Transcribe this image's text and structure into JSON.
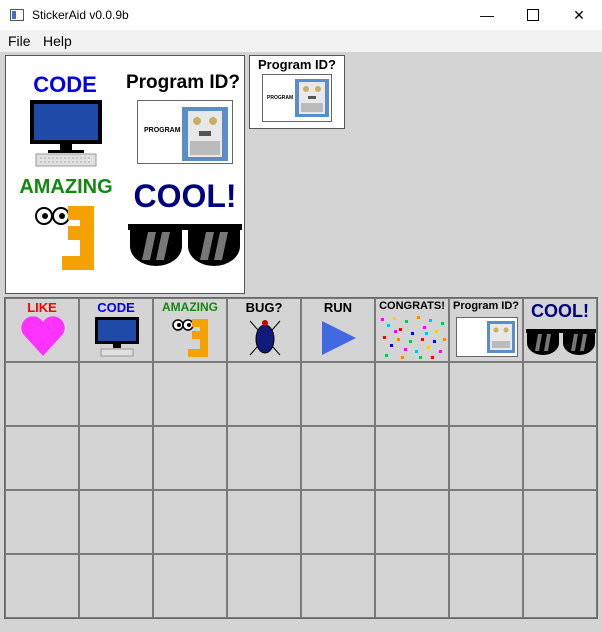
{
  "window": {
    "title": "StickerAid v0.0.9b"
  },
  "menu": [
    "File",
    "Help"
  ],
  "canvas": {
    "code_label": "CODE",
    "program_label": "Program ID?",
    "program_card_text": "PROGRAM",
    "amazing_label": "AMAZING",
    "cool_label": "COOL!"
  },
  "preview": {
    "label": "Program ID?",
    "card_text": "PROGRAM"
  },
  "stickers": [
    {
      "label": "LIKE",
      "icon": "heart-icon",
      "color": "#ff0000"
    },
    {
      "label": "CODE",
      "icon": "computer-icon",
      "color": "#0000ee"
    },
    {
      "label": "AMAZING",
      "icon": "amazing-face-icon",
      "color": "#118811"
    },
    {
      "label": "BUG?",
      "icon": "bug-icon",
      "color": "#000000"
    },
    {
      "label": "RUN",
      "icon": "play-icon",
      "color": "#000000"
    },
    {
      "label": "CONGRATS!",
      "icon": "confetti-icon",
      "color": "#000000"
    },
    {
      "label": "Program ID?",
      "icon": "program-card-icon",
      "color": "#000000"
    },
    {
      "label": "COOL!",
      "icon": "sunglasses-icon",
      "color": "#000080"
    }
  ],
  "grid": {
    "columns": 8,
    "rows": 5
  },
  "colors": {
    "heart": "#ff33ff",
    "screen": "#1f4aa8",
    "orange": "#f5a100",
    "robot": "#5b8dc8",
    "play": "#4169e1",
    "bug": "#101a7a"
  }
}
